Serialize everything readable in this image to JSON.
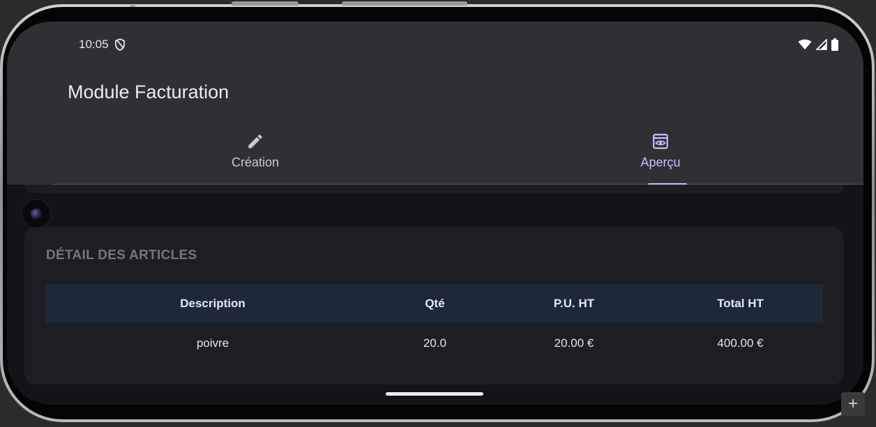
{
  "status_bar": {
    "time": "10:05",
    "icons": [
      "shield-icon",
      "wifi-icon",
      "signal-icon",
      "battery-icon"
    ]
  },
  "app_bar": {
    "title": "Module Facturation"
  },
  "tabs": [
    {
      "label": "Création",
      "icon": "edit-pencil-icon",
      "selected": false
    },
    {
      "label": "Aperçu",
      "icon": "preview-eye-icon",
      "selected": true
    }
  ],
  "colors": {
    "accent": "#cfbcff",
    "app_bar_bg": "#302f33",
    "screen_bg": "#141318",
    "card_bg": "#1e1d23",
    "table_header_bg": "#1d2838"
  },
  "card": {
    "title": "DÉTAIL DES ARTICLES",
    "table": {
      "headers": [
        "Description",
        "Qté",
        "P.U. HT",
        "Total HT"
      ],
      "rows": [
        [
          "poivre",
          "20.0",
          "20.00 €",
          "400.00 €"
        ]
      ]
    }
  },
  "corner_button": {
    "label": "+"
  }
}
